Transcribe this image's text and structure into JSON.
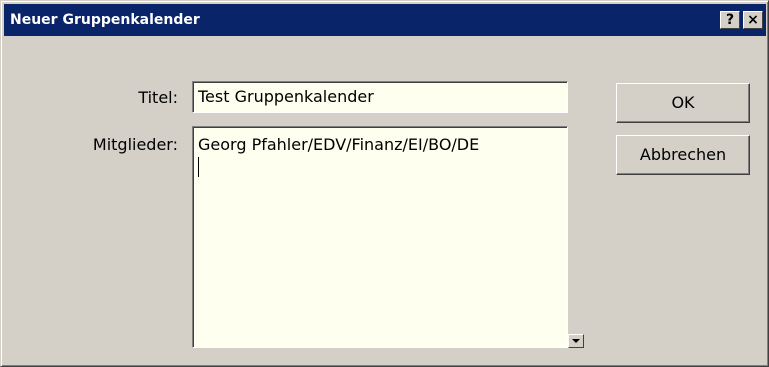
{
  "window": {
    "title": "Neuer Gruppenkalender",
    "help_label": "?",
    "close_label": "×"
  },
  "form": {
    "title_label": "Titel:",
    "title_value": "Test Gruppenkalender",
    "members_label": "Mitglieder:",
    "members_value": "Georg Pfahler/EDV/Finanz/EI/BO/DE"
  },
  "buttons": {
    "ok_label": "OK",
    "cancel_label": "Abbrechen"
  },
  "colors": {
    "titlebar": "#0a246a",
    "dialog_background": "#d4d0c8",
    "field_background": "#fffff0"
  },
  "icons": {
    "help": "help-icon",
    "close": "close-icon",
    "dropdown": "chevron-down-icon"
  }
}
